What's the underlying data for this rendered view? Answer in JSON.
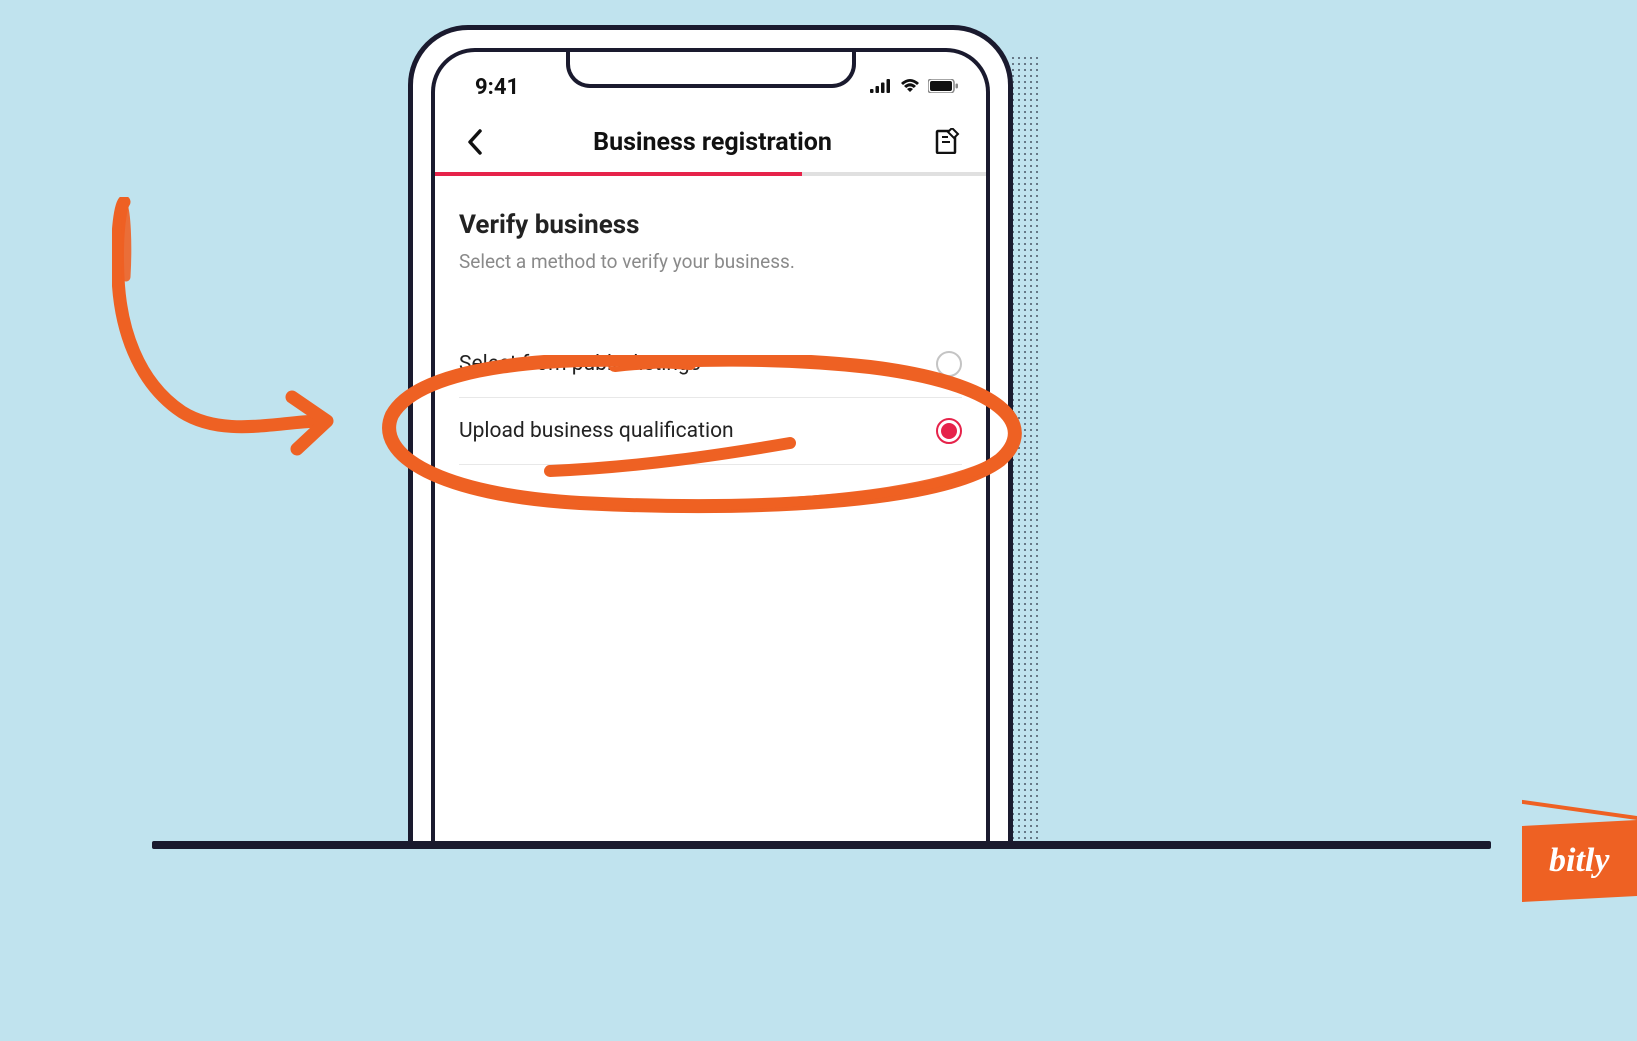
{
  "status": {
    "time": "9:41",
    "signal_icon": "cellular-signal-icon",
    "wifi_icon": "wifi-icon",
    "battery_icon": "battery-icon"
  },
  "nav": {
    "back_icon": "chevron-left-icon",
    "title": "Business registration",
    "action_icon": "document-edit-icon"
  },
  "progress": {
    "steps": 3,
    "current": 2
  },
  "content": {
    "heading": "Verify business",
    "subheading": "Select a method to verify your business.",
    "options": [
      {
        "label": "Select from public listings",
        "selected": false
      },
      {
        "label": "Upload business qualification",
        "selected": true
      }
    ]
  },
  "annotation": {
    "color": "#ee6123",
    "circled_option_index": 1
  },
  "brand": {
    "name": "bitly"
  }
}
